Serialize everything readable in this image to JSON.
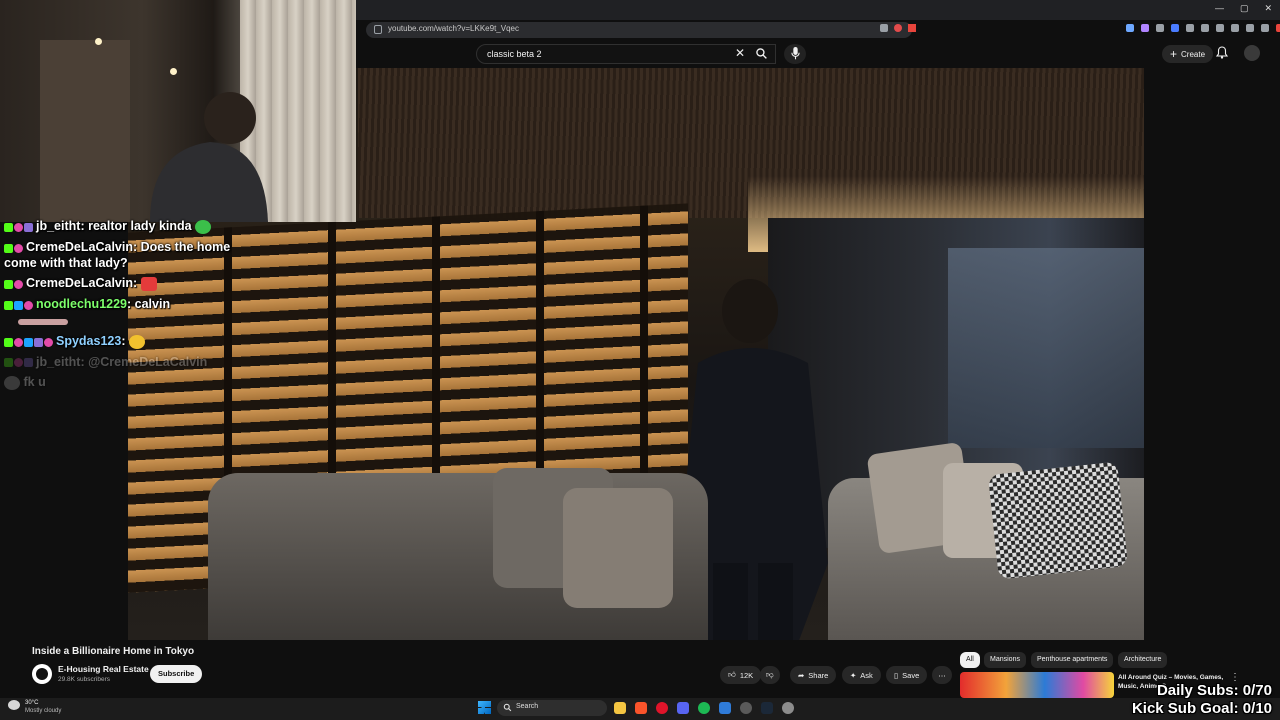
{
  "browser": {
    "url": "youtube.com/watch?v=LKKe9t_Vqec"
  },
  "youtube": {
    "search": {
      "query": "classic beta 2"
    },
    "create_label": "Create",
    "video": {
      "title": "Inside a Billionaire Home in Tokyo",
      "channel": "E-Housing Real Estate",
      "subscribers": "29.8K subscribers",
      "subscribe_label": "Subscribe",
      "likes": "12K",
      "share_label": "Share",
      "ask_label": "Ask",
      "save_label": "Save"
    },
    "chips": [
      "All",
      "Mansions",
      "Penthouse apartments",
      "Architecture"
    ],
    "recommended": {
      "title": "All Around Quiz – Movies, Games, Music, Anime C..."
    }
  },
  "chat": {
    "messages": [
      {
        "user": "jb_eitht",
        "text": "realtor lady kinda",
        "user_color": "#ffffff"
      },
      {
        "user": "CremeDeLaCalvin",
        "text": "Does the home come with that lady?",
        "user_color": "#ffffff"
      },
      {
        "user": "CremeDeLaCalvin",
        "text": "",
        "user_color": "#ffffff"
      },
      {
        "user": "noodlechu1229",
        "text": "calvin",
        "user_color": "#7dff6b"
      },
      {
        "user": "Spydas123",
        "text": "",
        "user_color": "#8fd0ff"
      },
      {
        "user": "jb_eitht",
        "text": "@CremeDeLaCalvin",
        "user_color": "#ffffff"
      },
      {
        "user": "",
        "text": "fk u",
        "user_color": "#ffffff"
      }
    ]
  },
  "overlay": {
    "daily_subs": "Daily Subs: 0/70",
    "kick_goal": "Kick Sub Goal: 0/10"
  },
  "taskbar": {
    "weather_temp": "30°C",
    "weather_desc": "Mostly cloudy",
    "search_label": "Search"
  },
  "colors": {
    "yt_bg": "#0f0f0f",
    "kick_green": "#53fc18",
    "pill_bg": "#272727"
  }
}
